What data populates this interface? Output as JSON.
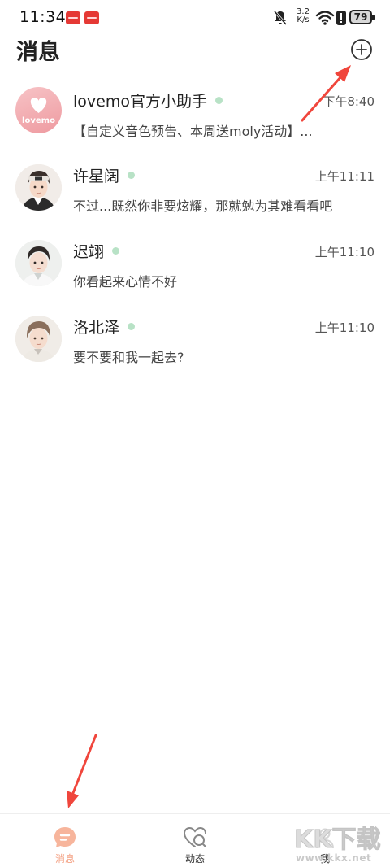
{
  "status_bar": {
    "time": "11:34",
    "net_speed_value": "3.2",
    "net_speed_unit": "K/s",
    "battery": "79",
    "icons": [
      "app-notification-icon",
      "app-notification-icon",
      "bell-off-icon",
      "wifi-icon",
      "warning-icon",
      "battery-icon"
    ]
  },
  "header": {
    "title": "消息",
    "add_icon": "plus-circle-icon"
  },
  "chats": [
    {
      "name": "lovemo官方小助手",
      "time": "下午8:40",
      "preview": "【自定义音色预告、本周送moly活动】...",
      "avatar_text": "lovemo",
      "online": true
    },
    {
      "name": "许星阔",
      "time": "上午11:11",
      "preview": "不过...既然你非要炫耀，那就勉为其难看看吧",
      "online": true
    },
    {
      "name": "迟翊",
      "time": "上午11:10",
      "preview": "你看起来心情不好",
      "online": true
    },
    {
      "name": "洛北泽",
      "time": "上午11:10",
      "preview": "要不要和我一起去?",
      "online": true
    }
  ],
  "bottom_nav": [
    {
      "label": "消息",
      "icon": "message-bubble-icon",
      "active": true
    },
    {
      "label": "动态",
      "icon": "heart-search-icon",
      "active": false
    },
    {
      "label": "我",
      "icon": "profile-icon",
      "active": false
    }
  ],
  "watermark": {
    "text": "www.kkx.net",
    "logo_text": "KK下载"
  },
  "colors": {
    "accent": "#f4a386",
    "online": "#b8e2c6",
    "arrow": "#f0463c"
  }
}
